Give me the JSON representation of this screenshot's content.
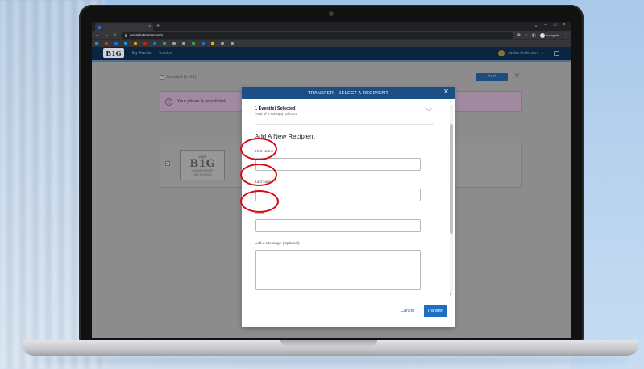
{
  "browser": {
    "tab_title": "",
    "url_host": "am.ticketmaster.com",
    "url_path": "",
    "incognito_label": "Incognito",
    "bookmarks": [
      {
        "label": "",
        "color": "#2b8ae6"
      },
      {
        "label": "",
        "color": "#d93025"
      },
      {
        "label": "",
        "color": "#1a73e8"
      },
      {
        "label": "",
        "color": "#1a9ae6"
      },
      {
        "label": "",
        "color": "#e8a21a"
      },
      {
        "label": "",
        "color": "#c5221f"
      },
      {
        "label": "",
        "color": "#1a73e8"
      },
      {
        "label": "",
        "color": "#34a853"
      },
      {
        "label": "",
        "color": "#9aa0a6"
      },
      {
        "label": "",
        "color": "#9aa0a6"
      },
      {
        "label": "",
        "color": "#34a853"
      },
      {
        "label": "",
        "color": "#1a73e8"
      },
      {
        "label": "",
        "color": "#f4b400"
      },
      {
        "label": "",
        "color": "#9aa0a6"
      },
      {
        "label": "",
        "color": "#9aa0a6"
      }
    ]
  },
  "site": {
    "logo": "B1G",
    "nav": [
      {
        "label": "My Events"
      },
      {
        "label": "Invoice"
      }
    ],
    "user_name": "Jackie Anderson"
  },
  "background": {
    "selected_text": "Selected (1 of 1)",
    "next_label": "Next",
    "banner_title": "Your phone is your ticket.",
    "banner_sub": "",
    "event_year": "2022",
    "event_logo": "B1G",
    "event_logo_sub": "CHAMPIONSHIP",
    "event_tag": "ONE DIVISION",
    "footer_links": "",
    "footer_copy": ""
  },
  "modal": {
    "title": "TRANSFER - SELECT A RECIPIENT",
    "events_selected": "1 Event(s) Selected",
    "events_sub": "Total of 2 ticket(s) selected",
    "add_title": "Add A New Recipient",
    "first_name_label": "First Name",
    "last_name_label": "Last Name",
    "email_label": "Email",
    "required_mark": "*",
    "message_label": "Add a Message (Optional)",
    "cancel_label": "Cancel",
    "transfer_label": "Transfer"
  },
  "colors": {
    "modal_header": "#1c4f86",
    "transfer_button": "#1f6fc0",
    "annotation_circle": "#d60a15"
  }
}
